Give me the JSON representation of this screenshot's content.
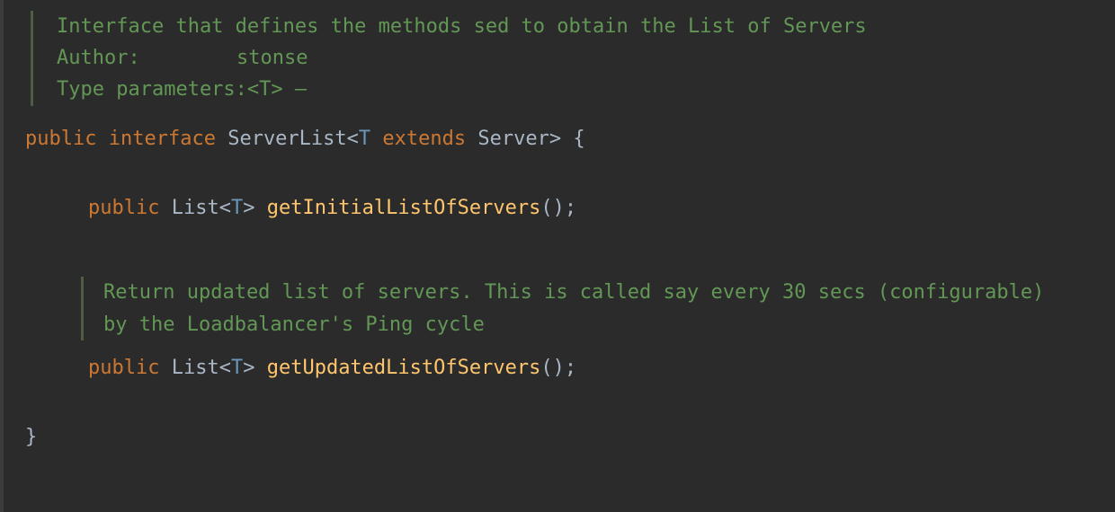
{
  "javadoc": {
    "description": "Interface that defines the methods sed to obtain the List of Servers",
    "author_label": "Author:",
    "author_value": "stonse",
    "type_params_label": "Type parameters:",
    "type_params_value": "<T> –"
  },
  "code": {
    "kw_public": "public",
    "kw_interface": "interface",
    "type_serverlist": "ServerList",
    "angle_open": "<",
    "gen_T": "T",
    "kw_extends": "extends",
    "type_server": "Server",
    "angle_close": ">",
    "brace_open": " {",
    "brace_close": "}",
    "type_list": "List",
    "method1": "getInitialListOfServers",
    "method2": "getUpdatedListOfServers",
    "parens_semi": "();"
  },
  "inner_javadoc": {
    "text": "Return updated list of servers. This is called say every 30 secs (configurable) by the Loadbalancer's Ping cycle"
  }
}
